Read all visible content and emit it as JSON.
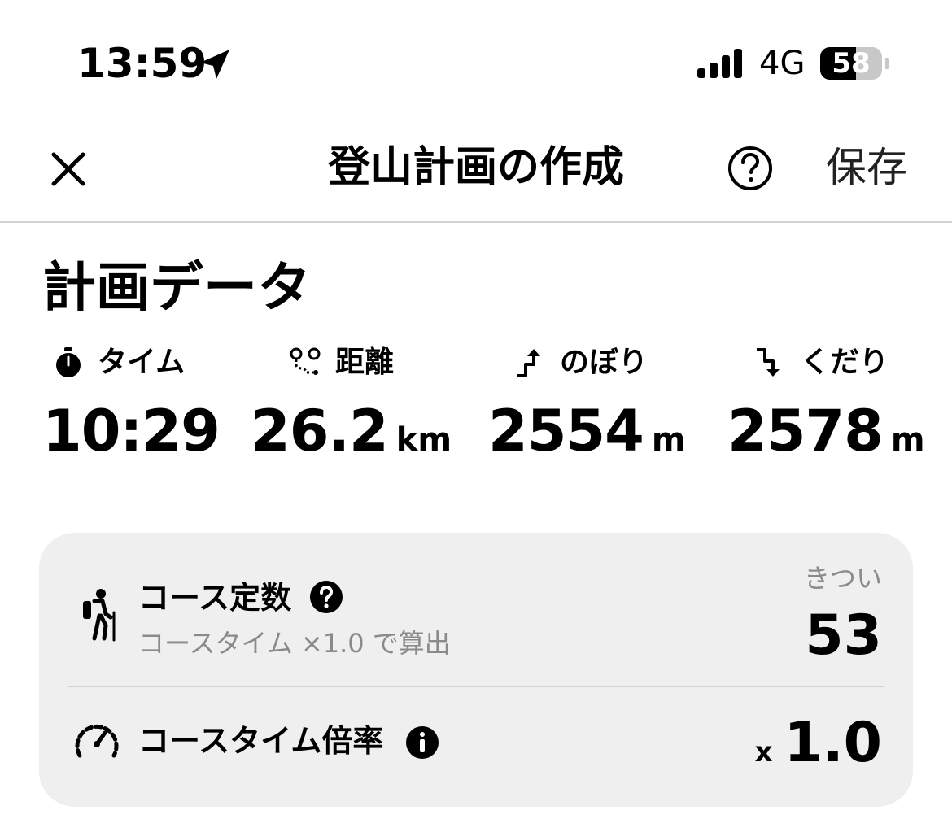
{
  "status_bar": {
    "time": "13:59",
    "network": "4G",
    "battery": "58",
    "battery_level": 0.58
  },
  "nav": {
    "title": "登山計画の作成",
    "save_label": "保存"
  },
  "plan": {
    "heading": "計画データ",
    "stats": [
      {
        "label": "タイム",
        "value": "10:29",
        "unit": "",
        "icon": "stopwatch-icon"
      },
      {
        "label": "距離",
        "value": "26.2",
        "unit": "km",
        "icon": "route-icon"
      },
      {
        "label": "のぼり",
        "value": "2554",
        "unit": "m",
        "icon": "ascent-icon"
      },
      {
        "label": "くだり",
        "value": "2578",
        "unit": "m",
        "icon": "descent-icon"
      }
    ]
  },
  "course": {
    "constant_title": "コース定数",
    "constant_subtitle": "コースタイム ×1.0 で算出",
    "difficulty": "きつい",
    "constant_value": "53",
    "multiplier_title": "コースタイム倍率",
    "multiplier_prefix": "x",
    "multiplier_value": "1.0"
  }
}
